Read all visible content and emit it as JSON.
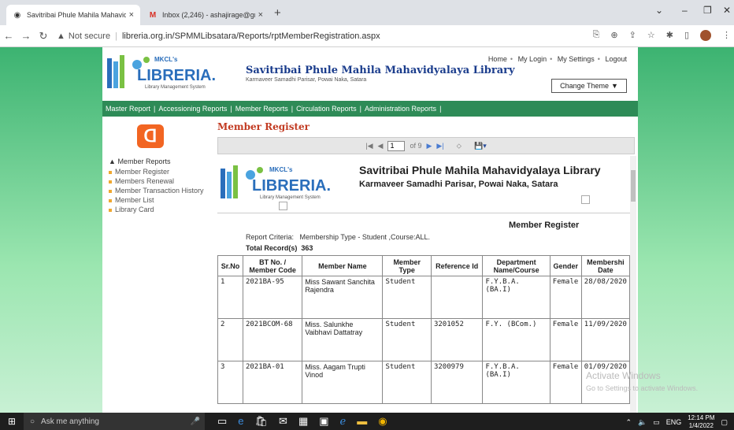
{
  "browser": {
    "tabs": [
      {
        "title": "Savitribai Phule Mahila Mahavid"
      },
      {
        "title": "Inbox (2,246) - ashajirage@gma"
      }
    ],
    "new_tab": "+",
    "url_prefix": "Not secure",
    "url": "libreria.org.in/SPMMLibsatara/Reports/rptMemberRegistration.aspx"
  },
  "header": {
    "logo_mkcl": "MKCL's",
    "logo_text": "LIBRERIA.",
    "logo_sub": "Library Management System",
    "title": "Savitribai Phule Mahila Mahavidyalaya Library",
    "subtitle": "Karmaveer Samadhi Parisar, Powai Naka, Satara",
    "links": [
      "Home",
      "My Login",
      "My Settings",
      "Logout"
    ],
    "change_theme": "Change Theme"
  },
  "menu": [
    "Master Report",
    "Accessioning Reports",
    "Member Reports",
    "Circulation Reports",
    "Administration Reports"
  ],
  "sidebar": {
    "heading": "Member Reports",
    "items": [
      "Member Register",
      "Members Renewal",
      "Member Transaction History",
      "Member List",
      "Library Card"
    ]
  },
  "content": {
    "title": "Member Register",
    "viewer": {
      "page": "1",
      "of": "of 9"
    },
    "report": {
      "title": "Savitribai Phule Mahila Mahavidyalaya Library",
      "subtitle": "Karmaveer Samadhi Parisar, Powai Naka, Satara",
      "heading": "Member Register",
      "criteria_label": "Report Criteria:",
      "criteria_value": "Membership Type - Student ,Course:ALL.",
      "total_label": "Total Record(s)",
      "total_value": "363",
      "columns": [
        "Sr.No",
        "BT No. / Member Code",
        "Member Name",
        "Member Type",
        "Reference Id",
        "Department Name/Course",
        "Gender",
        "Membershi Date"
      ],
      "rows": [
        [
          "1",
          "2021BA-95",
          "Miss Sawant Sanchita Rajendra",
          "Student",
          "",
          "F.Y.B.A. (BA.I)",
          "Female",
          "28/08/2020"
        ],
        [
          "2",
          "2021BCOM-68",
          "Miss. Salunkhe Vaibhavi Dattatray",
          "Student",
          "3201052",
          "F.Y. (BCom.)",
          "Female",
          "11/09/2020"
        ],
        [
          "3",
          "2021BA-01",
          "Miss. Aagam Trupti Vinod",
          "Student",
          "3200979",
          "F.Y.B.A. (BA.I)",
          "Female",
          "01/09/2020"
        ]
      ]
    }
  },
  "watermark": {
    "title": "Activate Windows",
    "sub": "Go to Settings to activate Windows."
  },
  "taskbar": {
    "search": "Ask me anything",
    "lang": "ENG",
    "time": "12:14 PM",
    "date": "1/4/2022"
  }
}
